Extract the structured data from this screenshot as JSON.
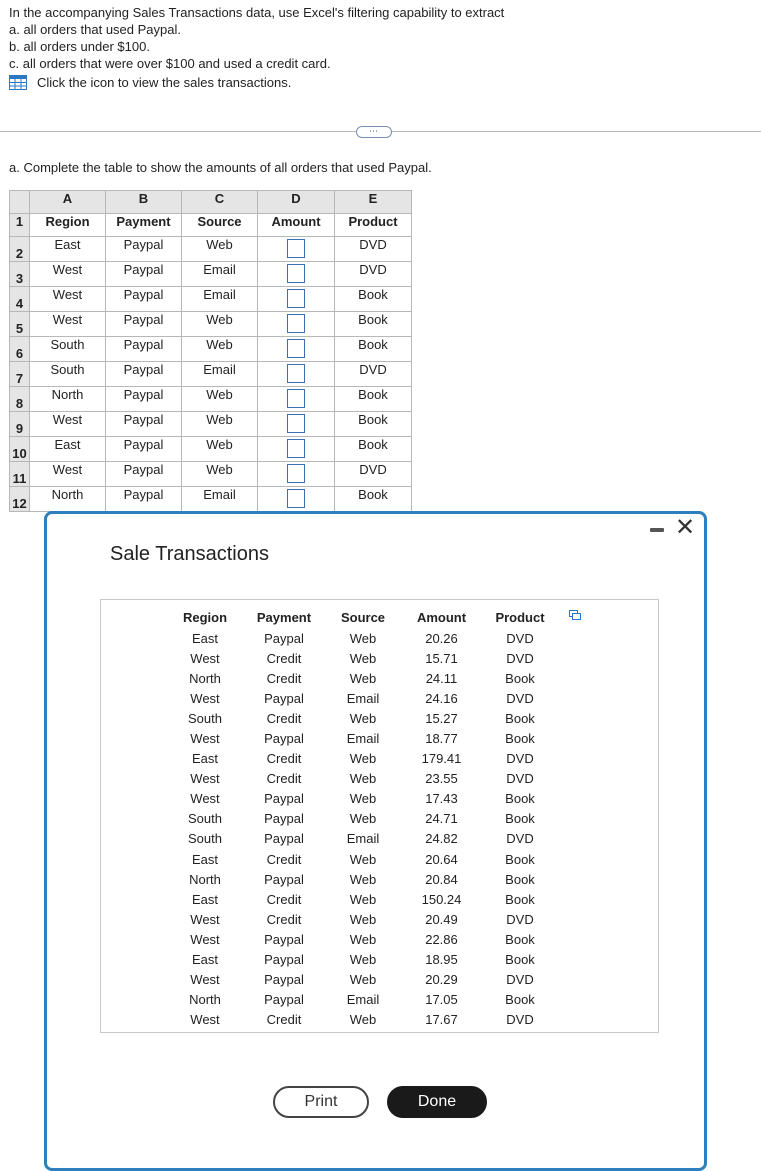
{
  "intro": {
    "line1": "In the accompanying Sales Transactions data, use Excel's filtering capability to extract",
    "item_a": "a. all orders that used Paypal.",
    "item_b": "b. all orders under $100.",
    "item_c": "c. all orders that were over $100 and used a credit card.",
    "link": "Click the icon to view the sales transactions."
  },
  "expand_button": "⋯",
  "part_a_prompt": "a. Complete the table to show the amounts of all orders that used Paypal.",
  "sheet": {
    "col_letters": [
      "A",
      "B",
      "C",
      "D",
      "E"
    ],
    "headers": [
      "Region",
      "Payment",
      "Source",
      "Amount",
      "Product"
    ],
    "row_numbers": [
      "1",
      "2",
      "3",
      "4",
      "5",
      "6",
      "7",
      "8",
      "9",
      "10",
      "11",
      "12"
    ],
    "rows": [
      {
        "region": "East",
        "payment": "Paypal",
        "source": "Web",
        "product": "DVD"
      },
      {
        "region": "West",
        "payment": "Paypal",
        "source": "Email",
        "product": "DVD"
      },
      {
        "region": "West",
        "payment": "Paypal",
        "source": "Email",
        "product": "Book"
      },
      {
        "region": "West",
        "payment": "Paypal",
        "source": "Web",
        "product": "Book"
      },
      {
        "region": "South",
        "payment": "Paypal",
        "source": "Web",
        "product": "Book"
      },
      {
        "region": "South",
        "payment": "Paypal",
        "source": "Email",
        "product": "DVD"
      },
      {
        "region": "North",
        "payment": "Paypal",
        "source": "Web",
        "product": "Book"
      },
      {
        "region": "West",
        "payment": "Paypal",
        "source": "Web",
        "product": "Book"
      },
      {
        "region": "East",
        "payment": "Paypal",
        "source": "Web",
        "product": "Book"
      },
      {
        "region": "West",
        "payment": "Paypal",
        "source": "Web",
        "product": "DVD"
      },
      {
        "region": "North",
        "payment": "Paypal",
        "source": "Email",
        "product": "Book"
      }
    ]
  },
  "modal": {
    "title": "Sale Transactions",
    "headers": [
      "Region",
      "Payment",
      "Source",
      "Amount",
      "Product"
    ],
    "rows": [
      [
        "East",
        "Paypal",
        "Web",
        "20.26",
        "DVD"
      ],
      [
        "West",
        "Credit",
        "Web",
        "15.71",
        "DVD"
      ],
      [
        "North",
        "Credit",
        "Web",
        "24.11",
        "Book"
      ],
      [
        "West",
        "Paypal",
        "Email",
        "24.16",
        "DVD"
      ],
      [
        "South",
        "Credit",
        "Web",
        "15.27",
        "Book"
      ],
      [
        "West",
        "Paypal",
        "Email",
        "18.77",
        "Book"
      ],
      [
        "East",
        "Credit",
        "Web",
        "179.41",
        "DVD"
      ],
      [
        "West",
        "Credit",
        "Web",
        "23.55",
        "DVD"
      ],
      [
        "West",
        "Paypal",
        "Web",
        "17.43",
        "Book"
      ],
      [
        "South",
        "Paypal",
        "Web",
        "24.71",
        "Book"
      ],
      [
        "South",
        "Paypal",
        "Email",
        "24.82",
        "DVD"
      ],
      [
        "East",
        "Credit",
        "Web",
        "20.64",
        "Book"
      ],
      [
        "North",
        "Paypal",
        "Web",
        "20.84",
        "Book"
      ],
      [
        "East",
        "Credit",
        "Web",
        "150.24",
        "Book"
      ],
      [
        "West",
        "Credit",
        "Web",
        "20.49",
        "DVD"
      ],
      [
        "West",
        "Paypal",
        "Web",
        "22.86",
        "Book"
      ],
      [
        "East",
        "Paypal",
        "Web",
        "18.95",
        "Book"
      ],
      [
        "West",
        "Paypal",
        "Web",
        "20.29",
        "DVD"
      ],
      [
        "North",
        "Paypal",
        "Email",
        "17.05",
        "Book"
      ],
      [
        "West",
        "Credit",
        "Web",
        "17.67",
        "DVD"
      ]
    ],
    "print_label": "Print",
    "done_label": "Done",
    "close_glyph": "✕"
  },
  "colors": {
    "accent": "#2d7fbe",
    "input_border": "#3a6fb3",
    "header_bg": "#e5e5e5"
  },
  "icons": [
    "spreadsheet-grid-icon",
    "minimize-icon",
    "close-icon",
    "copy-icon"
  ]
}
